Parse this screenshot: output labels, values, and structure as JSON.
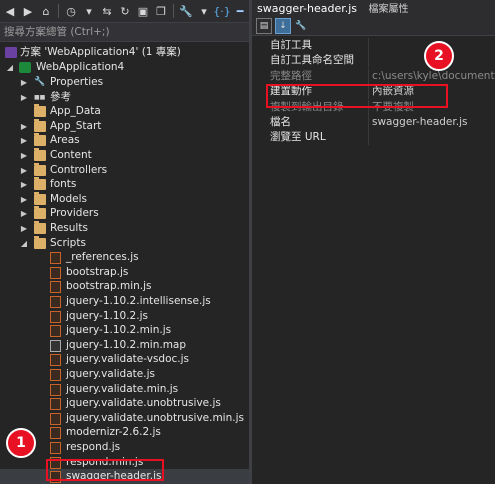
{
  "solution_explorer": {
    "search_placeholder": "搜尋方案總管 (Ctrl+;)",
    "solution_label": "方案 'WebApplication4' (1 專案)",
    "project_label": "WebApplication4",
    "items": [
      {
        "label": "Properties",
        "type": "wrench",
        "level": 2,
        "arrow": "▶"
      },
      {
        "label": "參考",
        "type": "ref",
        "level": 2,
        "arrow": "▶"
      },
      {
        "label": "App_Data",
        "type": "folder",
        "level": 2,
        "arrow": ""
      },
      {
        "label": "App_Start",
        "type": "folder",
        "level": 2,
        "arrow": "▶"
      },
      {
        "label": "Areas",
        "type": "folder",
        "level": 2,
        "arrow": "▶"
      },
      {
        "label": "Content",
        "type": "folder",
        "level": 2,
        "arrow": "▶"
      },
      {
        "label": "Controllers",
        "type": "folder",
        "level": 2,
        "arrow": "▶"
      },
      {
        "label": "fonts",
        "type": "folder",
        "level": 2,
        "arrow": "▶"
      },
      {
        "label": "Models",
        "type": "folder",
        "level": 2,
        "arrow": "▶"
      },
      {
        "label": "Providers",
        "type": "folder",
        "level": 2,
        "arrow": "▶"
      },
      {
        "label": "Results",
        "type": "folder",
        "level": 2,
        "arrow": "▶"
      },
      {
        "label": "Scripts",
        "type": "folder",
        "level": 2,
        "arrow": "◢"
      },
      {
        "label": "_references.js",
        "type": "js",
        "level": 3,
        "arrow": ""
      },
      {
        "label": "bootstrap.js",
        "type": "js",
        "level": 3,
        "arrow": ""
      },
      {
        "label": "bootstrap.min.js",
        "type": "js",
        "level": 3,
        "arrow": ""
      },
      {
        "label": "jquery-1.10.2.intellisense.js",
        "type": "js",
        "level": 3,
        "arrow": ""
      },
      {
        "label": "jquery-1.10.2.js",
        "type": "js",
        "level": 3,
        "arrow": ""
      },
      {
        "label": "jquery-1.10.2.min.js",
        "type": "js",
        "level": 3,
        "arrow": ""
      },
      {
        "label": "jquery-1.10.2.min.map",
        "type": "map",
        "level": 3,
        "arrow": ""
      },
      {
        "label": "jquery.validate-vsdoc.js",
        "type": "js",
        "level": 3,
        "arrow": ""
      },
      {
        "label": "jquery.validate.js",
        "type": "js",
        "level": 3,
        "arrow": ""
      },
      {
        "label": "jquery.validate.min.js",
        "type": "js",
        "level": 3,
        "arrow": ""
      },
      {
        "label": "jquery.validate.unobtrusive.js",
        "type": "js",
        "level": 3,
        "arrow": ""
      },
      {
        "label": "jquery.validate.unobtrusive.min.js",
        "type": "js",
        "level": 3,
        "arrow": ""
      },
      {
        "label": "modernizr-2.6.2.js",
        "type": "js",
        "level": 3,
        "arrow": ""
      },
      {
        "label": "respond.js",
        "type": "js",
        "level": 3,
        "arrow": ""
      },
      {
        "label": "respond.min.js",
        "type": "js",
        "level": 3,
        "arrow": ""
      },
      {
        "label": "swagger-header.js",
        "type": "js",
        "level": 3,
        "arrow": "",
        "selected": true
      }
    ],
    "badge_1": "1"
  },
  "properties": {
    "title": "swagger-header.js",
    "subtitle": "檔案屬性",
    "rows": [
      {
        "name": "自訂工具",
        "value": ""
      },
      {
        "name": "自訂工具命名空間",
        "value": ""
      },
      {
        "name": "完整路徑",
        "value": "c:\\users\\kyle\\documents\\v",
        "dim": true
      },
      {
        "name": "建置動作",
        "value": "內嵌資源",
        "highlight": true
      },
      {
        "name": "複製到輸出目錄",
        "value": "不要複製",
        "dim": true
      },
      {
        "name": "檔名",
        "value": "swagger-header.js"
      },
      {
        "name": "瀏覽至 URL",
        "value": ""
      }
    ],
    "badge_2": "2"
  },
  "colors": {
    "accent": "#e81123",
    "background": "#252526"
  }
}
